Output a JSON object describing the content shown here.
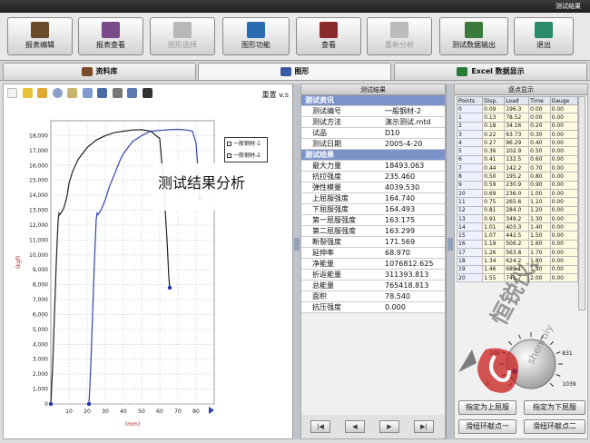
{
  "window": {
    "title": "测试结果"
  },
  "toolbar": [
    {
      "label": "报表编辑",
      "icon": "report-edit-icon",
      "enabled": true,
      "color": "#6b4b2a"
    },
    {
      "label": "报表查看",
      "icon": "report-view-icon",
      "enabled": true,
      "color": "#7a4a8a"
    },
    {
      "label": "图形选择",
      "icon": "graph-select-icon",
      "enabled": false,
      "color": "#b8b8b8"
    },
    {
      "label": "图形功能",
      "icon": "graph-function-icon",
      "enabled": true,
      "color": "#2b6cb0"
    },
    {
      "label": "查看",
      "icon": "view-icon",
      "enabled": true,
      "color": "#8a2b2b"
    },
    {
      "label": "重新分析",
      "icon": "reanalyze-icon",
      "enabled": false,
      "color": "#bcbcbc"
    },
    {
      "label": "测试数据输出",
      "icon": "data-export-icon",
      "enabled": true,
      "color": "#3a7a3a"
    },
    {
      "label": "退出",
      "icon": "exit-icon",
      "enabled": true,
      "color": "#2a8a6a"
    }
  ],
  "tabs": [
    {
      "label": "资料库",
      "icon": "database-icon",
      "active": false
    },
    {
      "label": "图形",
      "icon": "graph-icon",
      "active": true
    },
    {
      "label": "Excel 数据显示",
      "icon": "excel-icon",
      "active": false
    }
  ],
  "chart_toolbar": {
    "reset_label": "重置 v.s"
  },
  "overlay_text": "测试结果分析",
  "chart_data": {
    "type": "line",
    "xlabel": "(mm)",
    "ylabel": "(kgf)",
    "xlim": [
      0,
      90
    ],
    "ylim": [
      0,
      19000
    ],
    "xticks": [
      10,
      20,
      30,
      40,
      50,
      60,
      70,
      80
    ],
    "yticks": [
      0,
      1000,
      2000,
      3000,
      4000,
      5000,
      6000,
      7000,
      8000,
      9000,
      10000,
      11000,
      12000,
      13000,
      14000,
      15000,
      16000,
      17000,
      18000
    ],
    "series": [
      {
        "name": "一般钢材-1",
        "color": "#222222",
        "x": [
          0,
          1,
          2,
          3,
          4,
          4.5,
          5,
          6,
          7,
          8,
          9,
          10,
          12,
          15,
          20,
          25,
          30,
          35,
          40,
          45,
          50,
          55,
          60,
          62,
          64,
          65,
          65.5
        ],
        "y": [
          0,
          2500,
          6000,
          9500,
          12300,
          12800,
          12700,
          12900,
          13100,
          13500,
          14000,
          14800,
          15600,
          16400,
          17200,
          17700,
          18000,
          18200,
          18300,
          18380,
          18400,
          18300,
          17800,
          15000,
          11000,
          8500,
          7800
        ]
      },
      {
        "name": "一般钢材-2",
        "color": "#3344aa",
        "x": [
          21,
          22,
          23,
          24,
          25,
          25.5,
          26,
          27,
          28,
          30,
          32,
          35,
          38,
          40,
          45,
          50,
          55,
          60,
          65,
          70,
          75,
          78,
          80,
          81,
          82
        ],
        "y": [
          0,
          2500,
          6000,
          9500,
          12400,
          12800,
          12700,
          12900,
          13100,
          13700,
          14500,
          15400,
          16300,
          16800,
          17600,
          18000,
          18300,
          18350,
          18400,
          18420,
          18380,
          18300,
          17500,
          15800,
          13800
        ]
      }
    ]
  },
  "results": {
    "header": "测试结果",
    "rows": [
      {
        "k": "测试资讯",
        "v": "",
        "section": true
      },
      {
        "k": "测试编号",
        "v": "一般钢材-2"
      },
      {
        "k": "测试方法",
        "v": "演示测试.mtd"
      },
      {
        "k": "试品",
        "v": "D10"
      },
      {
        "k": "测试日期",
        "v": "2005-4-20"
      },
      {
        "k": "测试结果",
        "v": "",
        "section": true
      },
      {
        "k": "最大力量",
        "v": "18493.063"
      },
      {
        "k": "抗拉强度",
        "v": "235.460"
      },
      {
        "k": "弹性模量",
        "v": "4039.530"
      },
      {
        "k": "上屈服强度",
        "v": "164.740"
      },
      {
        "k": "下屈服强度",
        "v": "164.493"
      },
      {
        "k": "第一屈服强度",
        "v": "163.175"
      },
      {
        "k": "第二屈服强度",
        "v": "163.299"
      },
      {
        "k": "断裂强度",
        "v": "171.569"
      },
      {
        "k": "延伸率",
        "v": "68.970"
      },
      {
        "k": "净能量",
        "v": "1076812.625"
      },
      {
        "k": "折返能量",
        "v": "311393.813"
      },
      {
        "k": "总能量",
        "v": "765418.813"
      },
      {
        "k": "面积",
        "v": "78.540"
      },
      {
        "k": "抗压强度",
        "v": "0.000"
      }
    ],
    "nav": [
      "|◀",
      "◀",
      "▶",
      "▶|"
    ]
  },
  "points": {
    "header": "逐点显示",
    "columns": [
      "Points",
      "Disp.",
      "Load",
      "Time",
      "Gauge"
    ],
    "rows": [
      [
        "0",
        "0.09",
        "196.3",
        "0.00",
        "0.00"
      ],
      [
        "1",
        "0.13",
        "78.52",
        "0.00",
        "0.00"
      ],
      [
        "2",
        "0.18",
        "34.16",
        "0.20",
        "0.00"
      ],
      [
        "3",
        "0.22",
        "63.73",
        "0.30",
        "0.00"
      ],
      [
        "4",
        "0.27",
        "96.29",
        "0.40",
        "0.00"
      ],
      [
        "5",
        "0.36",
        "102.9",
        "0.50",
        "0.00"
      ],
      [
        "6",
        "0.41",
        "132.5",
        "0.60",
        "0.00"
      ],
      [
        "7",
        "0.44",
        "142.2",
        "0.70",
        "0.00"
      ],
      [
        "8",
        "0.50",
        "195.2",
        "0.80",
        "0.00"
      ],
      [
        "9",
        "0.59",
        "230.9",
        "0.90",
        "0.00"
      ],
      [
        "10",
        "0.69",
        "236.0",
        "1.00",
        "0.00"
      ],
      [
        "11",
        "0.75",
        "265.6",
        "1.10",
        "0.00"
      ],
      [
        "12",
        "0.81",
        "284.0",
        "1.20",
        "0.00"
      ],
      [
        "13",
        "0.91",
        "349.2",
        "1.30",
        "0.00"
      ],
      [
        "14",
        "1.01",
        "403.3",
        "1.40",
        "0.00"
      ],
      [
        "15",
        "1.07",
        "442.5",
        "1.50",
        "0.00"
      ],
      [
        "16",
        "1.19",
        "506.2",
        "1.60",
        "0.00"
      ],
      [
        "17",
        "1.26",
        "563.8",
        "1.70",
        "0.00"
      ],
      [
        "18",
        "1.34",
        "624.2",
        "1.80",
        "0.00"
      ],
      [
        "19",
        "1.46",
        "689.1",
        "1.90",
        "0.00"
      ],
      [
        "20",
        "1.55",
        "741.7",
        "2.00",
        "0.00"
      ]
    ],
    "knob_labels": [
      "208",
      "831",
      "0",
      "1039"
    ],
    "buttons": [
      "指定为上屈服",
      "指定为下屈服",
      "滑纽环献点一",
      "滑纽环献点二"
    ]
  },
  "watermark": {
    "text": "恒锐仪器",
    "sub": "shenruiy"
  }
}
